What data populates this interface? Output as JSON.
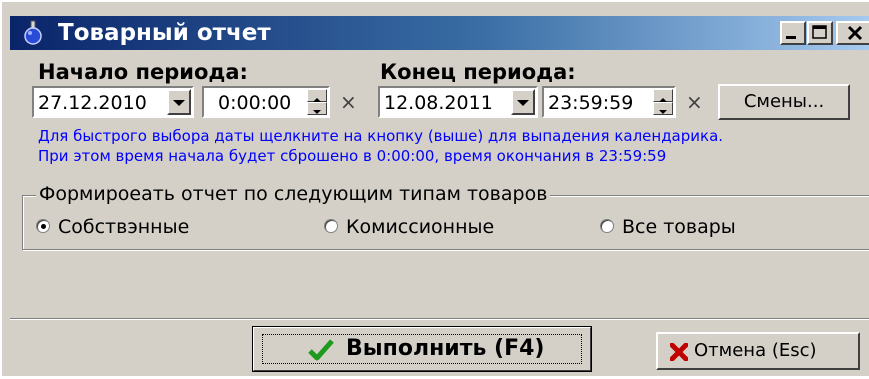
{
  "window": {
    "title": "Товарный отчет",
    "icon": "flask-icon"
  },
  "period_start": {
    "label": "Начало периода:",
    "date": "27.12.2010",
    "time": "0:00:00",
    "clear": "×"
  },
  "period_end": {
    "label": "Конец периода:",
    "date": "12.08.2011",
    "time": "23:59:59",
    "clear": "×"
  },
  "shifts_button": {
    "label": "Смены..."
  },
  "hint": {
    "line1": "Для быстрого выбора даты щелкните на кнопку (выше) для выпадения календарика.",
    "line2": "При этом время начала будет сброшено в 0:00:00, время окончания в 23:59:59"
  },
  "product_types": {
    "title": "Формироeать отчет по следующим типам товаров",
    "options": [
      {
        "label": "Собствэнные",
        "selected": true
      },
      {
        "label": "Комиссионные",
        "selected": false
      },
      {
        "label": "Все товары",
        "selected": false
      }
    ]
  },
  "actions": {
    "run_label": "Выполнить (F4)",
    "run_icon": "checkmark-icon",
    "cancel_label": "Отмена (Esc)",
    "cancel_icon": "cross-icon"
  },
  "colors": {
    "title_gradient_start": "#0a246a",
    "title_gradient_end": "#a6caf0",
    "hint_text": "#0000ff",
    "face": "#d4d0c8",
    "check_green": "#1e9a1e",
    "cross_red": "#c00000"
  }
}
